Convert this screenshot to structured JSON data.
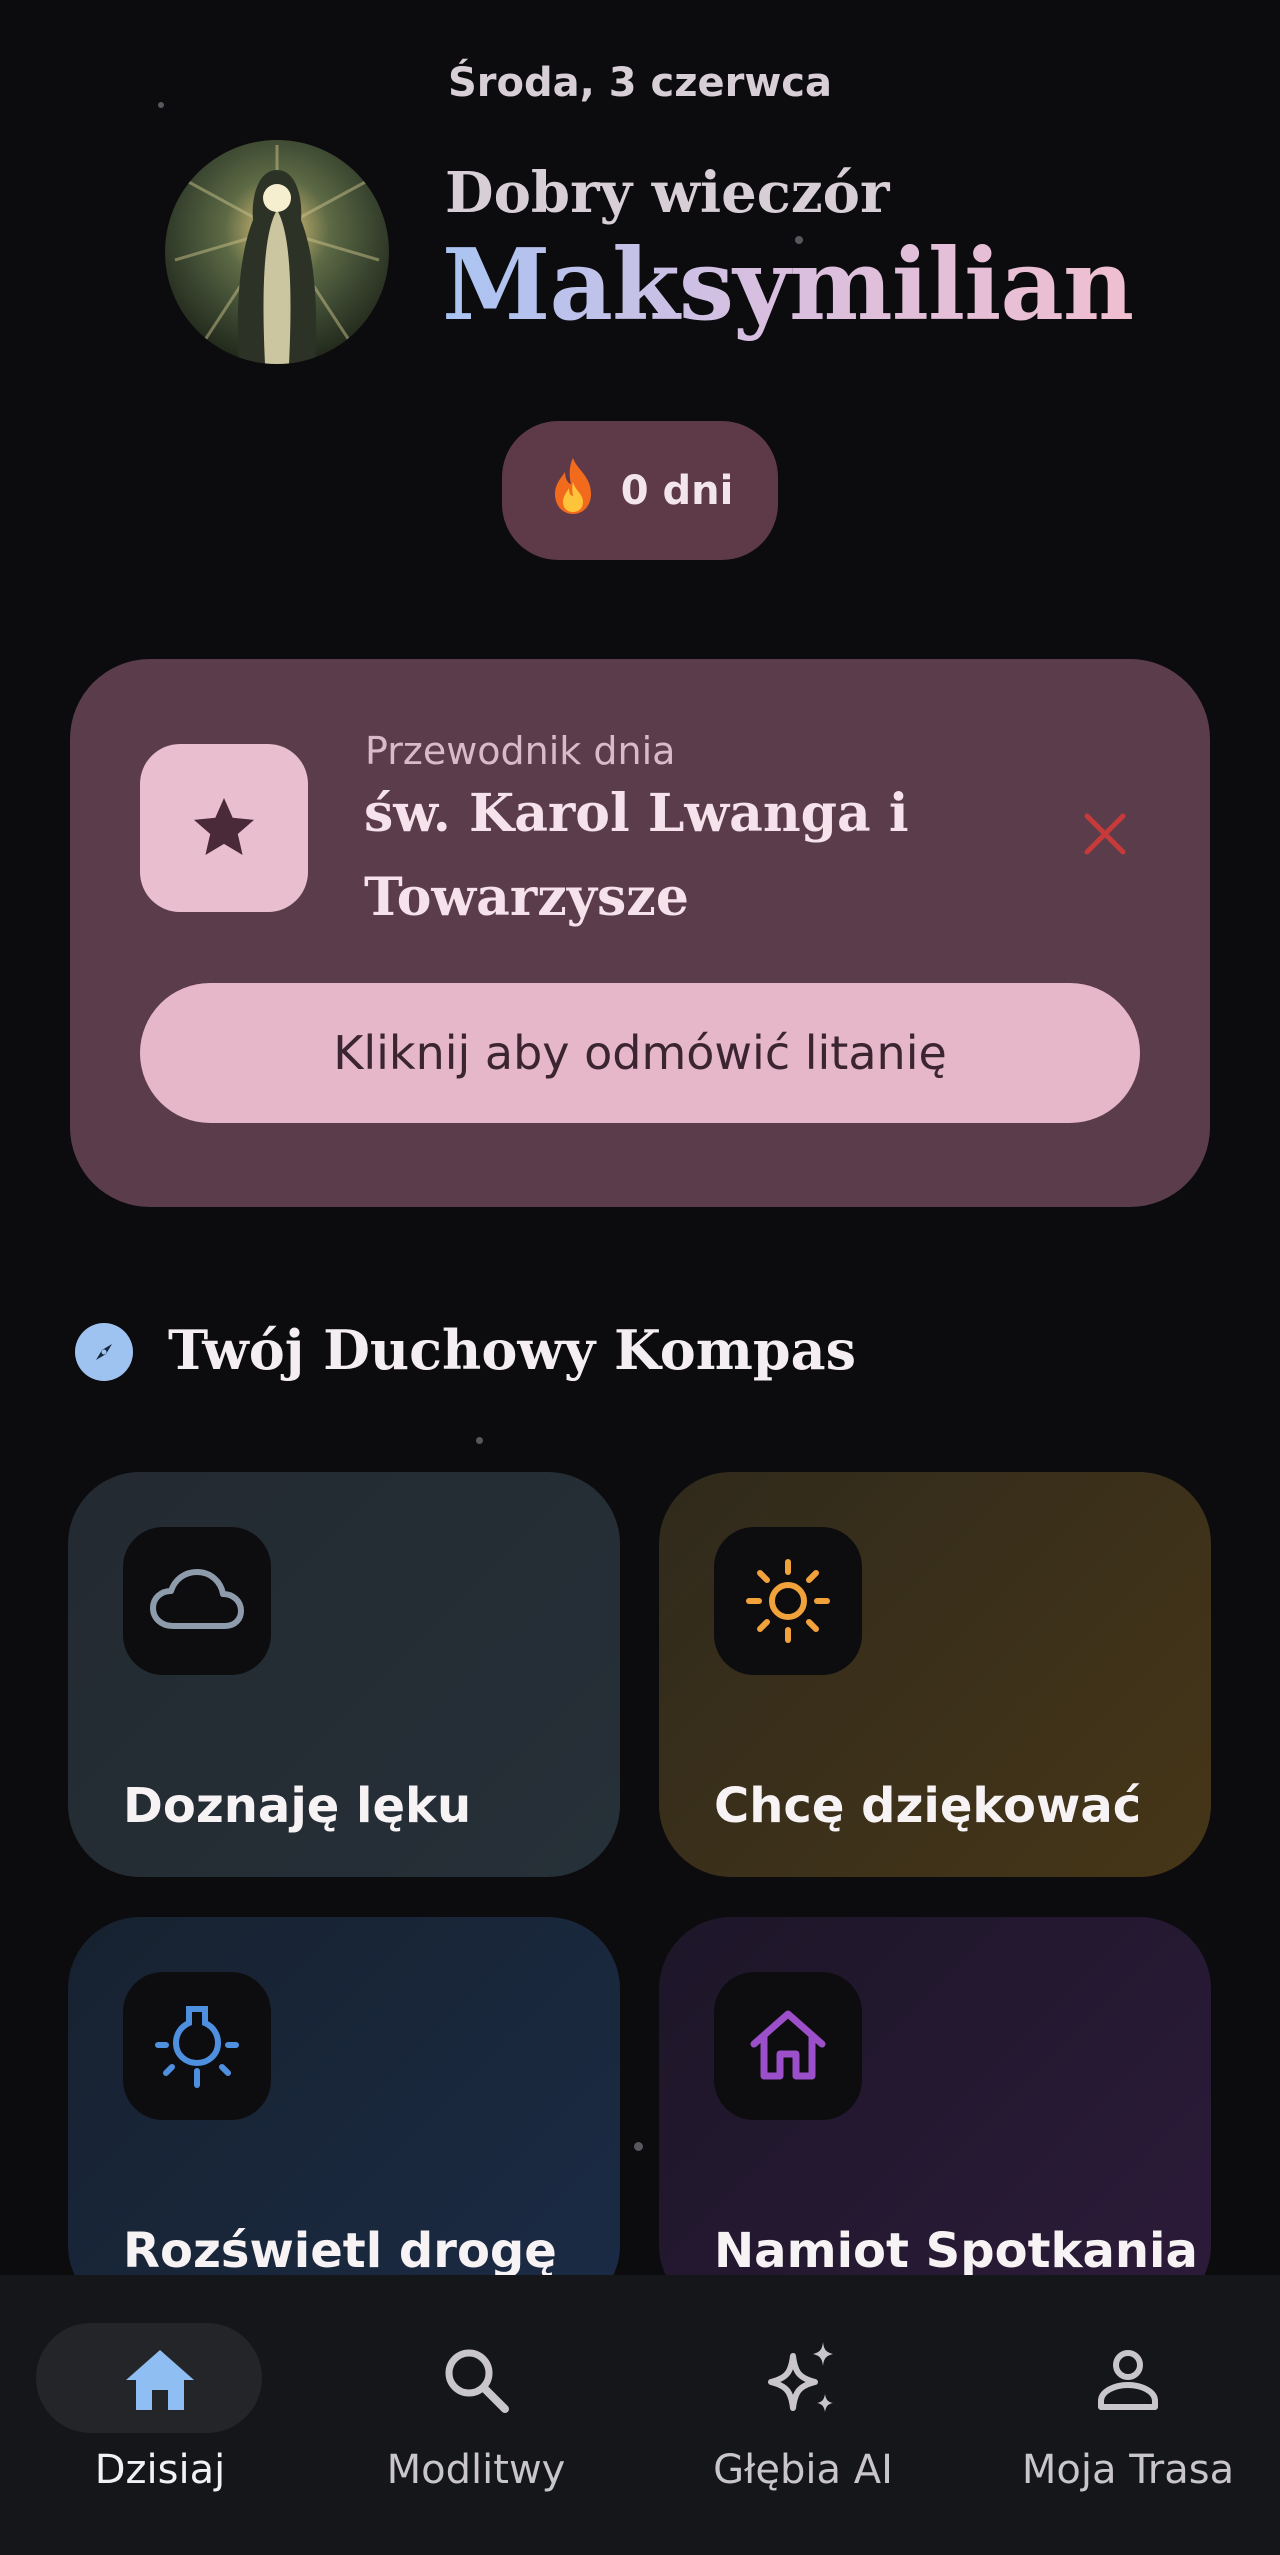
{
  "header": {
    "date": "Środa, 3 czerwca",
    "greeting": "Dobry wieczór",
    "username": "Maksymilian",
    "avatar_icon": "saint-portrait-image"
  },
  "streak": {
    "icon": "flame-icon",
    "label": "0 dni"
  },
  "guide": {
    "label": "Przewodnik dnia",
    "name": "św. Karol Lwanga i Towarzysze",
    "icon": "star-icon",
    "close_icon": "close-icon",
    "button_label": "Kliknij aby odmówić litanię",
    "accent": "#e6b7c8",
    "close_color": "#c73a3a"
  },
  "compass": {
    "title": "Twój Duchowy Kompas",
    "icon": "compass-icon",
    "tiles": [
      {
        "label": "Doznaję lęku",
        "icon": "cloud-icon",
        "icon_color": "#8d9bab"
      },
      {
        "label": "Chcę dziękować",
        "icon": "sun-icon",
        "icon_color": "#f2a23a"
      },
      {
        "label": "Rozświetl drogę",
        "icon": "lightbulb-icon",
        "icon_color": "#4f8fe0"
      },
      {
        "label": "Namiot Spotkania",
        "icon": "home-icon",
        "icon_color": "#9b4fc8"
      }
    ]
  },
  "nav": {
    "items": [
      {
        "label": "Dzisiaj",
        "icon": "home-icon",
        "active": true
      },
      {
        "label": "Modlitwy",
        "icon": "search-icon",
        "active": false
      },
      {
        "label": "Głębia AI",
        "icon": "sparkles-icon",
        "active": false
      },
      {
        "label": "Moja Trasa",
        "icon": "person-icon",
        "active": false
      }
    ],
    "active_color": "#8fbef2"
  }
}
